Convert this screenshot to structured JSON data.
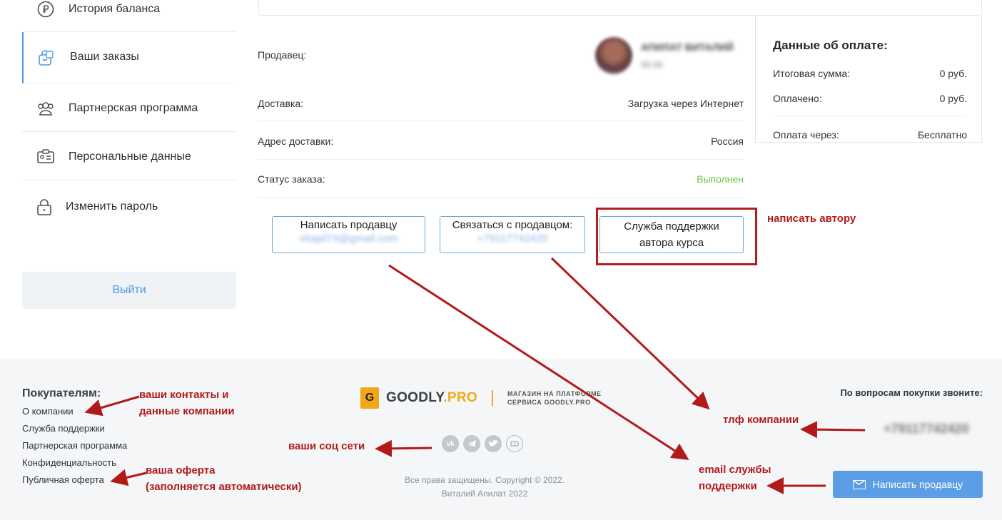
{
  "sidebar": {
    "items": [
      {
        "label": "История баланса",
        "icon": "ruble-icon"
      },
      {
        "label": "Ваши заказы",
        "icon": "orders-bag-icon"
      },
      {
        "label": "Партнерская программа",
        "icon": "partners-icon"
      },
      {
        "label": "Персональные данные",
        "icon": "id-card-icon"
      },
      {
        "label": "Изменить пароль",
        "icon": "lock-icon"
      }
    ],
    "logout_label": "Выйти"
  },
  "order": {
    "seller_label": "Продавец:",
    "seller_name": "АПИЛАТ ВИТАЛИЙ",
    "seller_sub": "00-00",
    "delivery_label": "Доставка:",
    "delivery_value": "Загрузка через Интернет",
    "address_label": "Адрес доставки:",
    "address_value": "Россия",
    "status_label": "Статус заказа:",
    "status_value": "Выполнен",
    "status_color": "#6cc24a"
  },
  "actions": {
    "write_seller": "Написать продавцу",
    "write_seller_email": "vitapil74@gmail.com",
    "contact_seller": "Связаться с продавцом:",
    "contact_seller_phone": "+79117742420",
    "support_line1": "Служба поддержки",
    "support_line2": "автора курса"
  },
  "payment": {
    "title": "Данные об оплате:",
    "total_label": "Итоговая сумма:",
    "total_value": "0 руб.",
    "paid_label": "Оплачено:",
    "paid_value": "0 руб.",
    "via_label": "Оплата через:",
    "via_value": "Бесплатно"
  },
  "annotations": {
    "write_author": "написать автору",
    "contacts_line1": "ваши контакты и",
    "contacts_line2": "данные компании",
    "social": "ваши соц сети",
    "offer_line1": "ваша оферта",
    "offer_line2": "(заполняется автоматически)",
    "phone": "тлф компании",
    "email_line1": "email службы",
    "email_line2": "поддержки",
    "color": "#b21a1a"
  },
  "footer": {
    "heading": "Покупателям:",
    "links": [
      "О компании",
      "Служба поддержки",
      "Партнерская программа",
      "Конфиденциальность",
      "Публичная оферта"
    ],
    "logo_letter": "G",
    "logo_name": "GOODLY",
    "logo_pro": ".PRO",
    "logo_tag1": "МАГАЗИН НА ПЛАТФОРМЕ",
    "logo_tag2": "СЕРВИСА GOODLY.PRO",
    "socials": [
      "vk-icon",
      "telegram-icon",
      "twitter-icon",
      "youtube-icon"
    ],
    "copyright1": "Все права защищены. Copyright © 2022.",
    "copyright2": "Виталий Апилат 2022",
    "call_label": "По вопросам покупки звоните:",
    "phone": "+79117742420",
    "write_button": "Написать продавцу",
    "accent": "#f2a71b",
    "button_color": "#5b9ee5"
  }
}
